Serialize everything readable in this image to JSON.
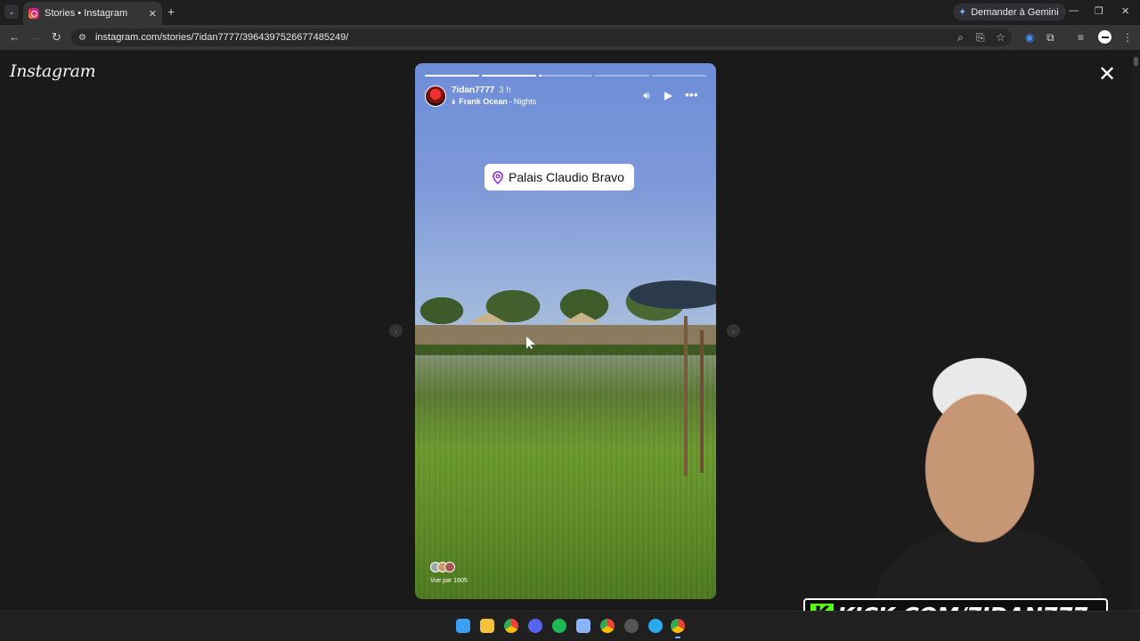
{
  "browser": {
    "tab_title": "Stories • Instagram",
    "new_tab_icon": "+",
    "gemini_label": "Demander à Gemini",
    "url": "instagram.com/stories/7idan7777/3964397526677485249/",
    "window_controls": [
      "minimize-icon",
      "restore-icon",
      "close-icon"
    ]
  },
  "instagram": {
    "logo_text": "Instagram",
    "close_icon": "✕"
  },
  "story": {
    "progress_segments": [
      1,
      1,
      0.05,
      0,
      0
    ],
    "username": "7idan7777",
    "time": "3 h",
    "music_artist": "Frank Ocean",
    "music_separator": "-",
    "music_track": "Nights",
    "location": "Palais Claudio Bravo",
    "viewers_label": "Vue par 1605"
  },
  "overlay": {
    "kick_letter": "K",
    "kick_url": "KICK.COM/7IDAN777"
  },
  "colors": {
    "accent_kick": "#53fc18",
    "location_pin": "#8a2be2"
  }
}
